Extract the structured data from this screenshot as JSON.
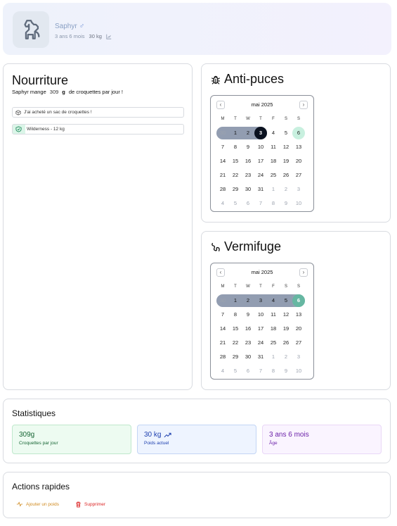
{
  "header": {
    "pet_name": "Saphyr",
    "sex_symbol": "♂",
    "age": "3 ans 6 mois",
    "weight": "30 kg"
  },
  "food": {
    "title": "Nourriture",
    "sentence_prefix": "Saphyr mange",
    "amount": "309",
    "unit": "g",
    "sentence_suffix": "de croquettes par jour !",
    "bought_label": "J'ai acheté un sac de croquettes !",
    "bag_label": "Wilderness - 12 kg"
  },
  "flea": {
    "title": "Anti-puces",
    "month": "mai 2025",
    "weekdays": [
      "M",
      "T",
      "W",
      "T",
      "F",
      "S",
      "S"
    ],
    "weeks": [
      [
        "30",
        "1",
        "2",
        "3",
        "4",
        "5",
        "6"
      ],
      [
        "7",
        "8",
        "9",
        "10",
        "11",
        "12",
        "13"
      ],
      [
        "14",
        "15",
        "16",
        "17",
        "18",
        "19",
        "20"
      ],
      [
        "21",
        "22",
        "23",
        "24",
        "25",
        "26",
        "27"
      ],
      [
        "28",
        "29",
        "30",
        "31",
        "1",
        "2",
        "3"
      ],
      [
        "4",
        "5",
        "6",
        "7",
        "8",
        "9",
        "10"
      ]
    ]
  },
  "worm": {
    "title": "Vermifuge",
    "month": "mai 2025",
    "weekdays": [
      "M",
      "T",
      "W",
      "T",
      "F",
      "S",
      "S"
    ],
    "weeks": [
      [
        "30",
        "1",
        "2",
        "3",
        "4",
        "5",
        "6"
      ],
      [
        "7",
        "8",
        "9",
        "10",
        "11",
        "12",
        "13"
      ],
      [
        "14",
        "15",
        "16",
        "17",
        "18",
        "19",
        "20"
      ],
      [
        "21",
        "22",
        "23",
        "24",
        "25",
        "26",
        "27"
      ],
      [
        "28",
        "29",
        "30",
        "31",
        "1",
        "2",
        "3"
      ],
      [
        "4",
        "5",
        "6",
        "7",
        "8",
        "9",
        "10"
      ]
    ]
  },
  "stats": {
    "title": "Statistiques",
    "food_value": "309g",
    "food_label": "Croquettes par jour",
    "weight_value": "30 kg",
    "weight_label": "Poids actuel",
    "age_value": "3 ans 6 mois",
    "age_label": "Âge"
  },
  "actions": {
    "title": "Actions rapides",
    "add_weight": "Ajouter un poids",
    "delete": "Supprimer"
  }
}
